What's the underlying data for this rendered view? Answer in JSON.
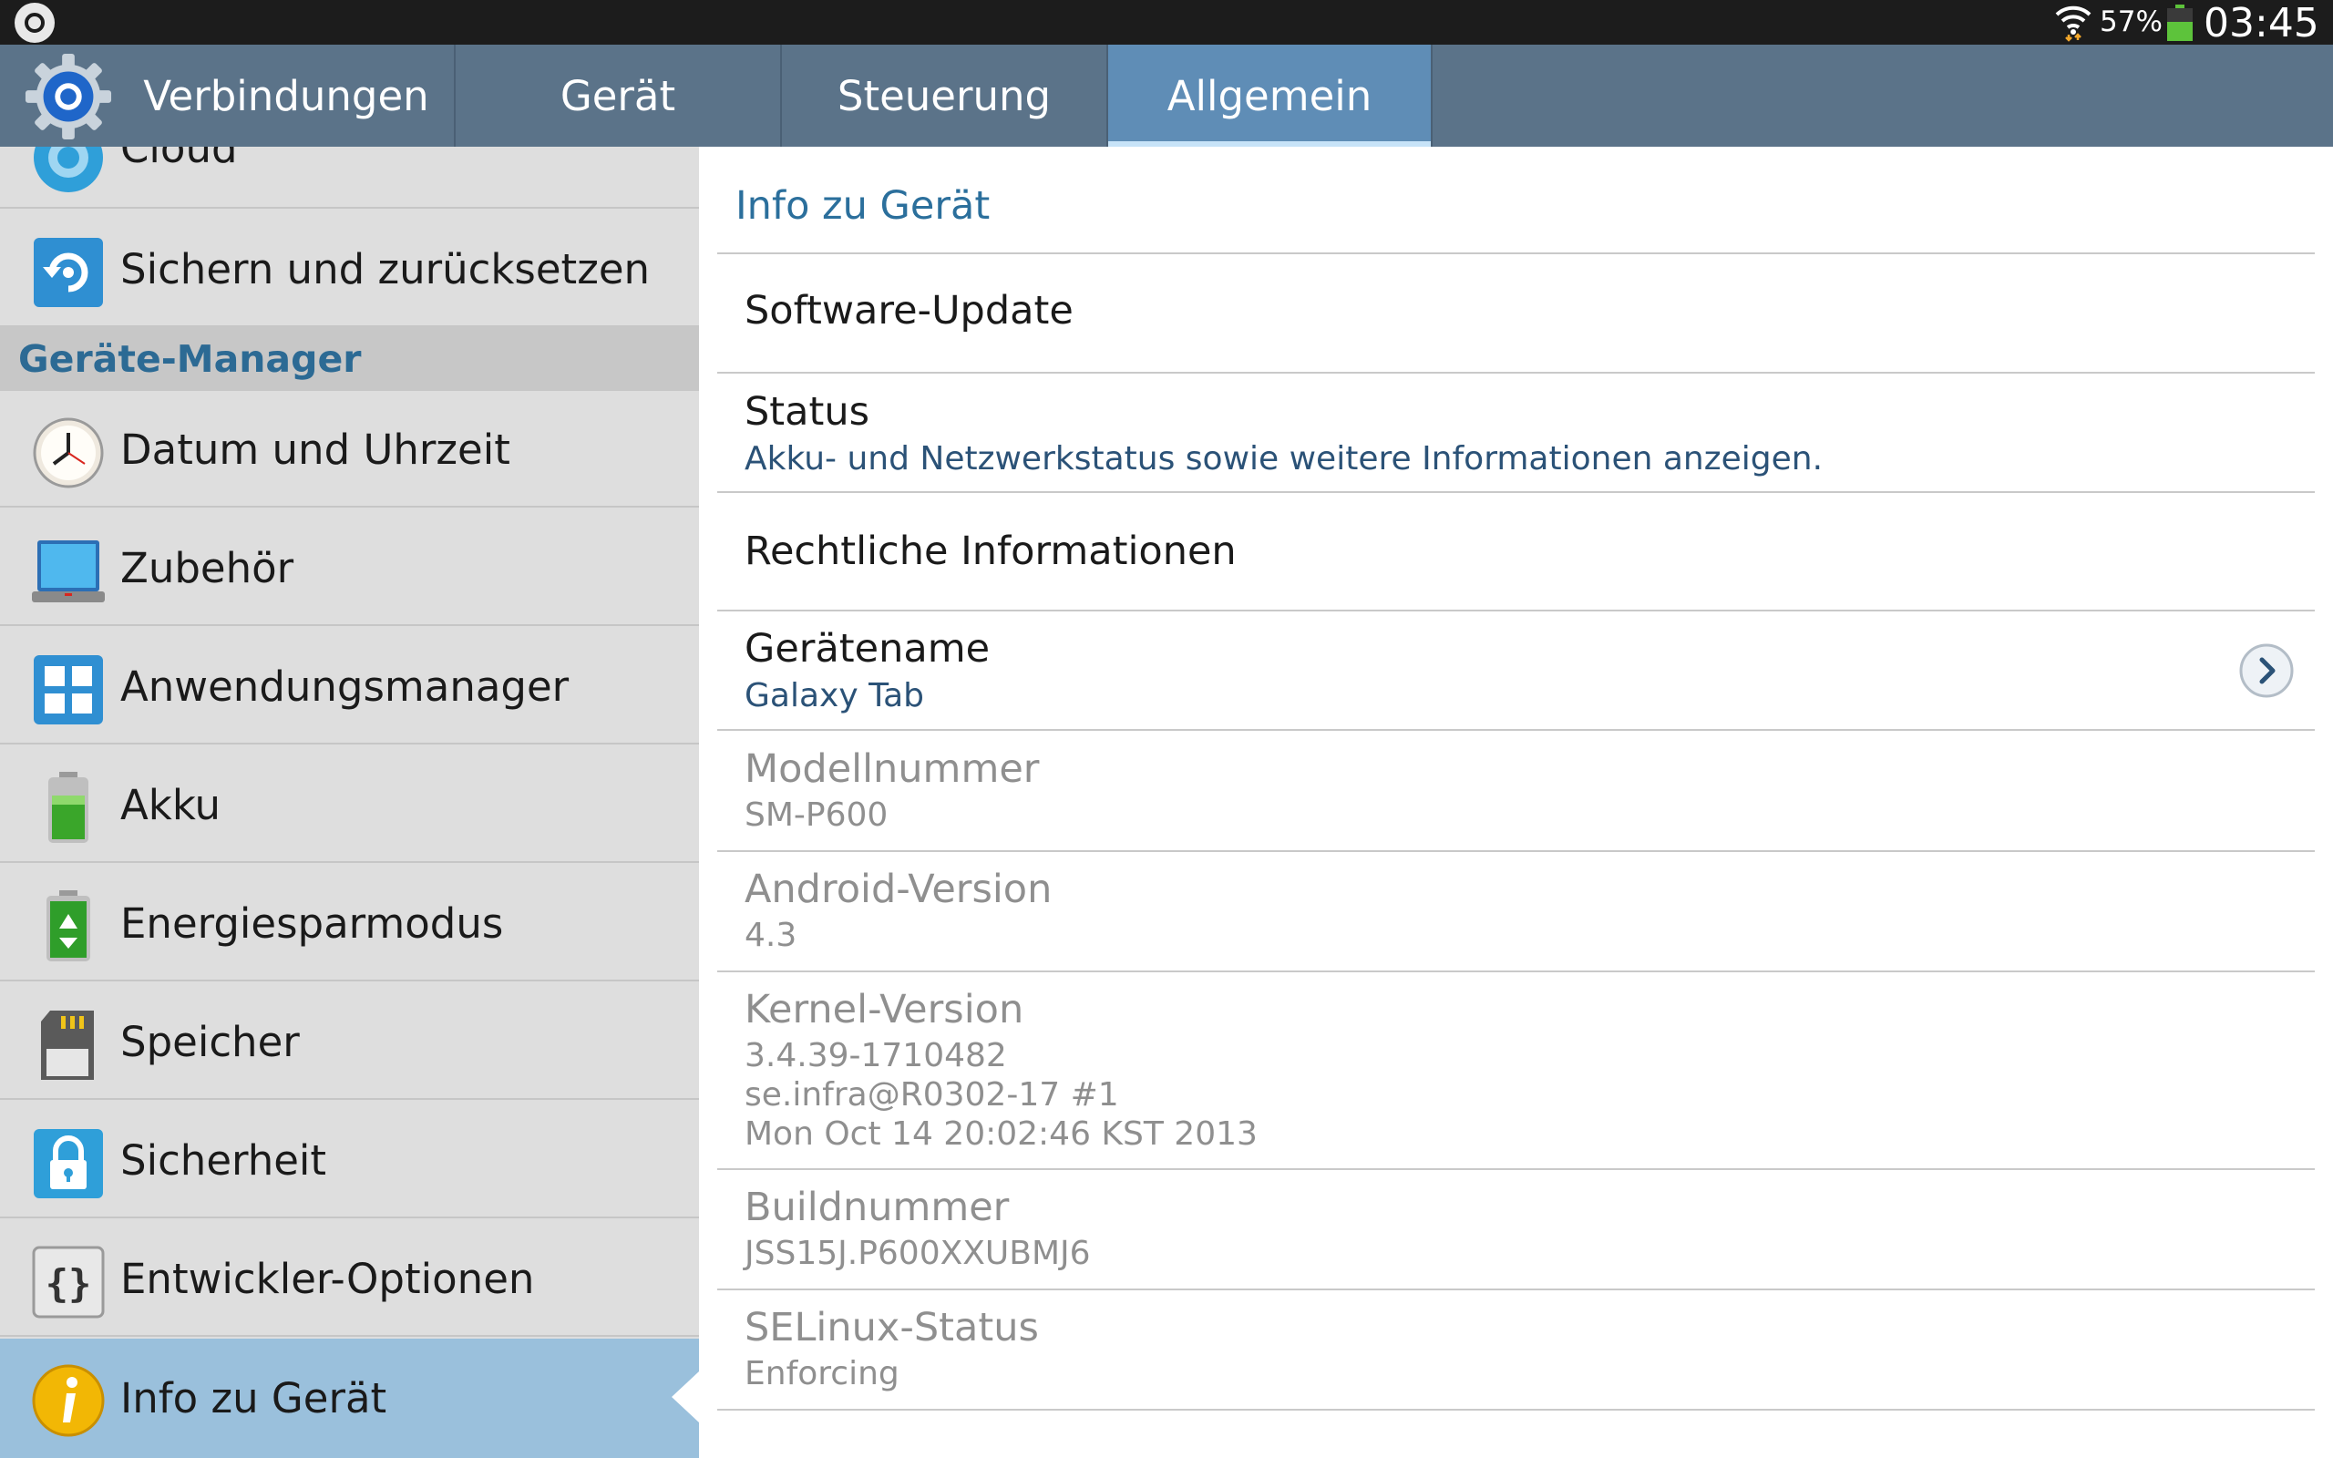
{
  "status_bar": {
    "battery_percent": "57%",
    "clock": "03:45",
    "icons": [
      "app-notification-icon",
      "wifi-icon",
      "battery-icon"
    ]
  },
  "tabs": [
    {
      "label": "Verbindungen",
      "active": false
    },
    {
      "label": "Gerät",
      "active": false
    },
    {
      "label": "Steuerung",
      "active": false
    },
    {
      "label": "Allgemein",
      "active": true
    }
  ],
  "sidebar": {
    "partial_item": {
      "label": "Cloud",
      "icon": "cloud-icon"
    },
    "backup_item": {
      "label": "Sichern und zurücksetzen",
      "icon": "backup-icon"
    },
    "section_header": "Geräte-Manager",
    "items": [
      {
        "label": "Datum und Uhrzeit",
        "icon": "clock-icon"
      },
      {
        "label": "Zubehör",
        "icon": "accessory-icon"
      },
      {
        "label": "Anwendungsmanager",
        "icon": "app-manager-icon"
      },
      {
        "label": "Akku",
        "icon": "battery-icon"
      },
      {
        "label": "Energiesparmodus",
        "icon": "power-saving-icon"
      },
      {
        "label": "Speicher",
        "icon": "storage-icon"
      },
      {
        "label": "Sicherheit",
        "icon": "lock-icon"
      },
      {
        "label": "Entwickler-Optionen",
        "icon": "developer-icon"
      },
      {
        "label": "Info zu Gerät",
        "icon": "info-icon",
        "active": true
      }
    ]
  },
  "content": {
    "title": "Info zu Gerät",
    "software_update": "Software-Update",
    "status": {
      "title": "Status",
      "subtitle": "Akku- und Netzwerkstatus sowie weitere Informationen anzeigen."
    },
    "legal": "Rechtliche Informationen",
    "device_name": {
      "title": "Gerätename",
      "value": "Galaxy Tab"
    },
    "model": {
      "title": "Modellnummer",
      "value": "SM-P600"
    },
    "android": {
      "title": "Android-Version",
      "value": "4.3"
    },
    "kernel": {
      "title": "Kernel-Version",
      "line1": "3.4.39-1710482",
      "line2": "se.infra@R0302-17 #1",
      "line3": "Mon Oct 14 20:02:46 KST 2013"
    },
    "build": {
      "title": "Buildnummer",
      "value": "JSS15J.P600XXUBMJ6"
    },
    "selinux": {
      "title": "SELinux-Status",
      "value": "Enforcing"
    }
  },
  "colors": {
    "tab_bar": "#5b7389",
    "tab_active": "#5f8db6",
    "sidebar_bg": "#dedede",
    "sidebar_active": "#9ac0dc",
    "section_header_text": "#2c6a94",
    "content_title": "#2b6f9c"
  }
}
